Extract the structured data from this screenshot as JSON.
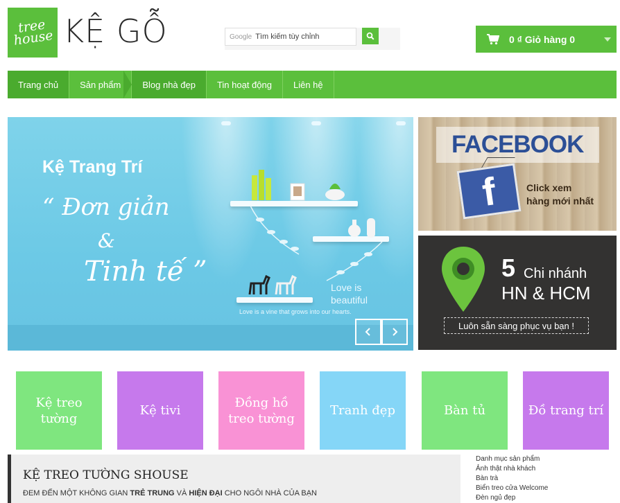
{
  "header": {
    "logo_text": "tree house",
    "site_name": "KỆ GỖ",
    "search": {
      "google_label": "Google",
      "value": "Tìm kiếm tùy chỉnh"
    },
    "cart": {
      "label": "0 ₫ Giỏ hàng 0"
    }
  },
  "nav": {
    "items": [
      {
        "label": "Trang chủ"
      },
      {
        "label": "Sản phẩm"
      },
      {
        "label": "Blog nhà đẹp"
      },
      {
        "label": "Tin hoạt động"
      },
      {
        "label": "Liên hệ"
      }
    ]
  },
  "hero": {
    "title": "Kệ Trang Trí",
    "line1": "“ Đơn giản",
    "line2": "&",
    "line3": "Tinh tế ”",
    "love1": "Love is",
    "love2": "beautiful",
    "love3": "Love is a vine that grows into our hearts."
  },
  "facebook_banner": {
    "title": "FACEBOOK",
    "sign_letter": "f",
    "cta_line1": "Click xem",
    "cta_line2": "hàng mới nhất"
  },
  "branch_banner": {
    "number": "5",
    "line1": "Chi nhánh",
    "line2": "HN & HCM",
    "tagline": "Luôn sẵn sàng phục vụ bạn !"
  },
  "categories": [
    {
      "label": "Kệ treo tường",
      "color": "#7fe67f"
    },
    {
      "label": "Kệ tivi",
      "color": "#c679ec"
    },
    {
      "label": "Đồng hồ treo tường",
      "color": "#f992d5"
    },
    {
      "label": "Tranh đẹp",
      "color": "#85d6f7"
    },
    {
      "label": "Bàn tủ",
      "color": "#7fe67f"
    },
    {
      "label": "Đồ trang trí",
      "color": "#c679ec"
    }
  ],
  "section": {
    "heading": "KỆ TREO TƯỜNG SHOUSE",
    "sub_a": "ĐEM ĐẾN MỘT KHÔNG GIAN ",
    "sub_b": "TRẺ TRUNG",
    "sub_c": " VÀ ",
    "sub_d": "HIỆN ĐẠI",
    "sub_e": " CHO NGÔI NHÀ CỦA BẠN"
  },
  "side_links": [
    {
      "label": "Danh mục sản phẩm"
    },
    {
      "label": "Ảnh thật nhà khách"
    },
    {
      "label": "Bàn trà"
    },
    {
      "label": "Biển treo cửa Welcome"
    },
    {
      "label": "Đèn ngủ đẹp"
    }
  ],
  "colors": {
    "brand_green": "#5bbf3c",
    "dark_panel": "#333231",
    "facebook_blue": "#2c4f96"
  }
}
